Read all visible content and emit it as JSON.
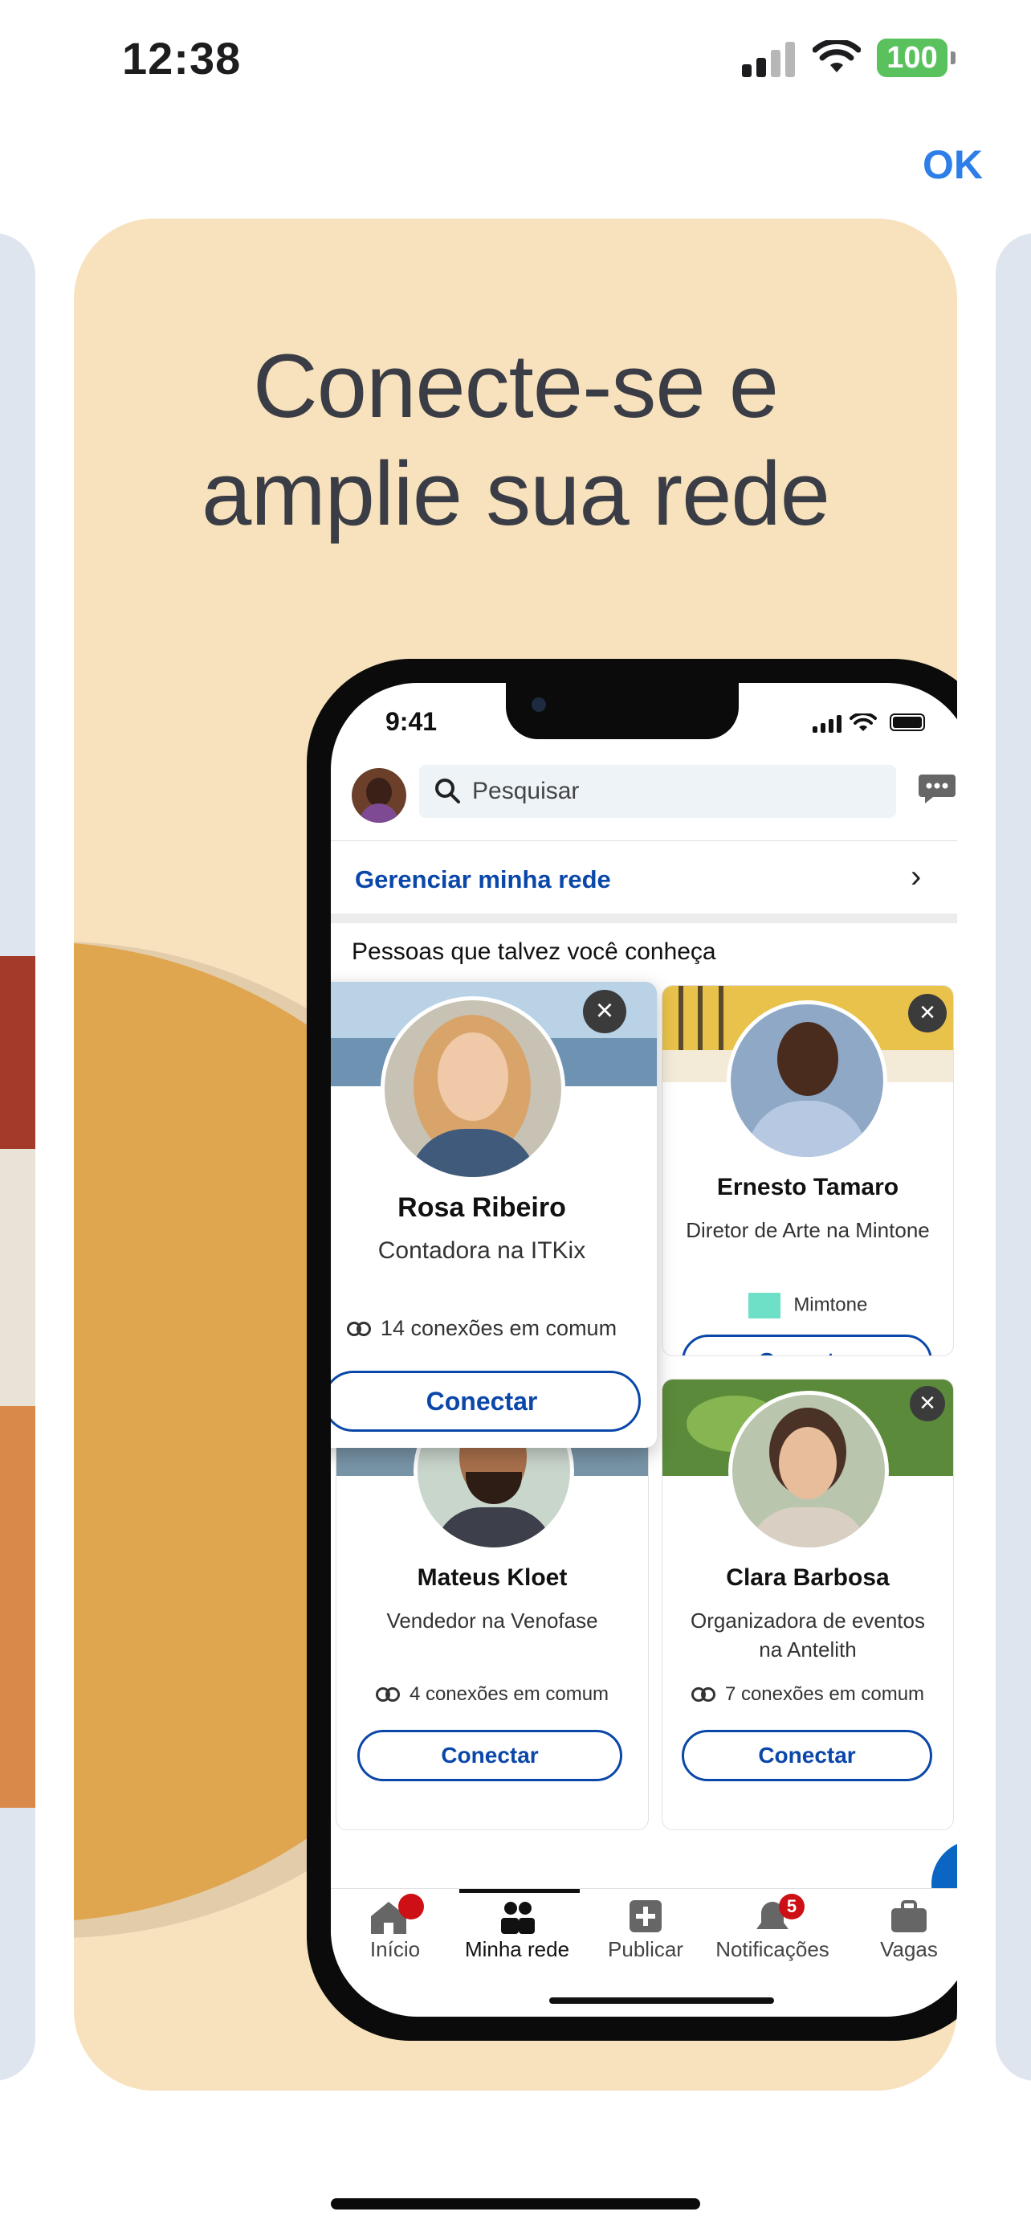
{
  "status_bar": {
    "time": "12:38",
    "battery": "100"
  },
  "top_bar": {
    "ok_label": "OK"
  },
  "promo": {
    "headline_line1": "Conecte-se e",
    "headline_line2": "amplie sua rede"
  },
  "phone": {
    "status_time": "9:41",
    "search_placeholder": "Pesquisar",
    "manage_label": "Gerenciar minha rede",
    "section_title": "Pessoas que talvez você conheça",
    "people": [
      {
        "name": "Rosa Ribeiro",
        "role": "Contadora na ITKix",
        "mutual": "14 conexões em comum",
        "action": "Conectar"
      },
      {
        "name": "Ernesto Tamaro",
        "role": "Diretor de Arte na Mintone",
        "company": "Mimtone",
        "action": "Conectar"
      },
      {
        "name": "Mateus Kloet",
        "role": "Vendedor na Venofase",
        "mutual": "4 conexões em comum",
        "action": "Conectar"
      },
      {
        "name": "Clara Barbosa",
        "role": "Organizadora de eventos na Antelith",
        "mutual": "7 conexões em comum",
        "action": "Conectar"
      }
    ],
    "nav": [
      {
        "label": "Início",
        "badge": ""
      },
      {
        "label": "Minha rede"
      },
      {
        "label": "Publicar"
      },
      {
        "label": "Notificações",
        "badge": "5"
      },
      {
        "label": "Vagas"
      }
    ]
  },
  "colors": {
    "card_bg": "#f8e2bd",
    "accent_blue": "#0a47a9",
    "ok_blue": "#2d7ee8",
    "circle": "#e0a64f"
  }
}
